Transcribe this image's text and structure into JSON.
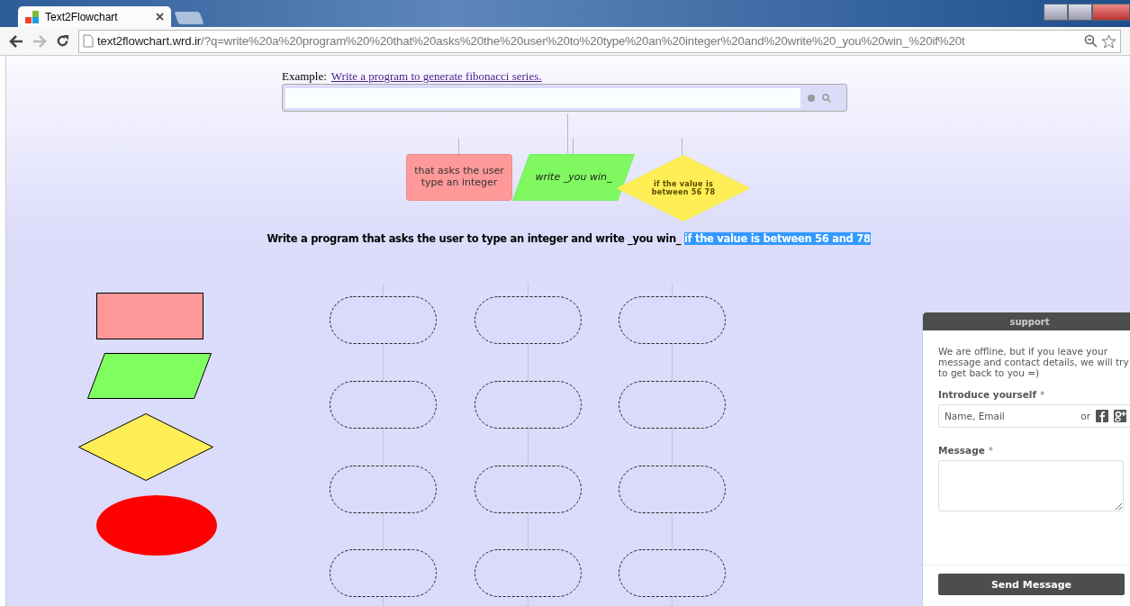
{
  "browser": {
    "tab_title": "Text2Flowchart",
    "url_host": "text2flowchart.wrd.ir",
    "url_path": "/?q=write%20a%20program%20%20that%20asks%20the%20user%20to%20type%20an%20integer%20and%20write%20_you%20win_%20if%20t"
  },
  "page": {
    "example_label": "Example:",
    "example_link": "Write a program to generate fibonacci series.",
    "flowchart": [
      {
        "kind": "process",
        "text": "that asks the user type an integer"
      },
      {
        "kind": "io",
        "text": "write _you win_"
      },
      {
        "kind": "decision",
        "text": "if the value is between 56 78"
      }
    ],
    "sentence": [
      {
        "text": "Write a program that asks the user to type an integer and write _you win_ ",
        "highlighted": false
      },
      {
        "text": "if the value is between 56 and 78",
        "highlighted": true
      }
    ],
    "palette": [
      {
        "kind": "process"
      },
      {
        "kind": "io"
      },
      {
        "kind": "decision"
      },
      {
        "kind": "terminal"
      }
    ],
    "slot_columns": [
      {
        "slots": [
          {
            "kind": "empty"
          },
          {
            "kind": "empty"
          },
          {
            "kind": "empty"
          },
          {
            "kind": "empty"
          }
        ]
      },
      {
        "slots": [
          {
            "kind": "empty"
          },
          {
            "kind": "empty"
          },
          {
            "kind": "empty"
          },
          {
            "kind": "empty"
          }
        ]
      },
      {
        "slots": [
          {
            "kind": "empty"
          },
          {
            "kind": "empty"
          },
          {
            "kind": "empty"
          },
          {
            "kind": "empty"
          }
        ]
      }
    ]
  },
  "support": {
    "title": "support",
    "intro": "We are offline, but if you leave your message and contact details, we will try to get back to you =)",
    "name_label": "Introduce yourself",
    "name_required": "*",
    "name_placeholder": "Name, Email",
    "or_text": "or",
    "message_label": "Message",
    "message_required": "*",
    "send_button": "Send Message"
  }
}
